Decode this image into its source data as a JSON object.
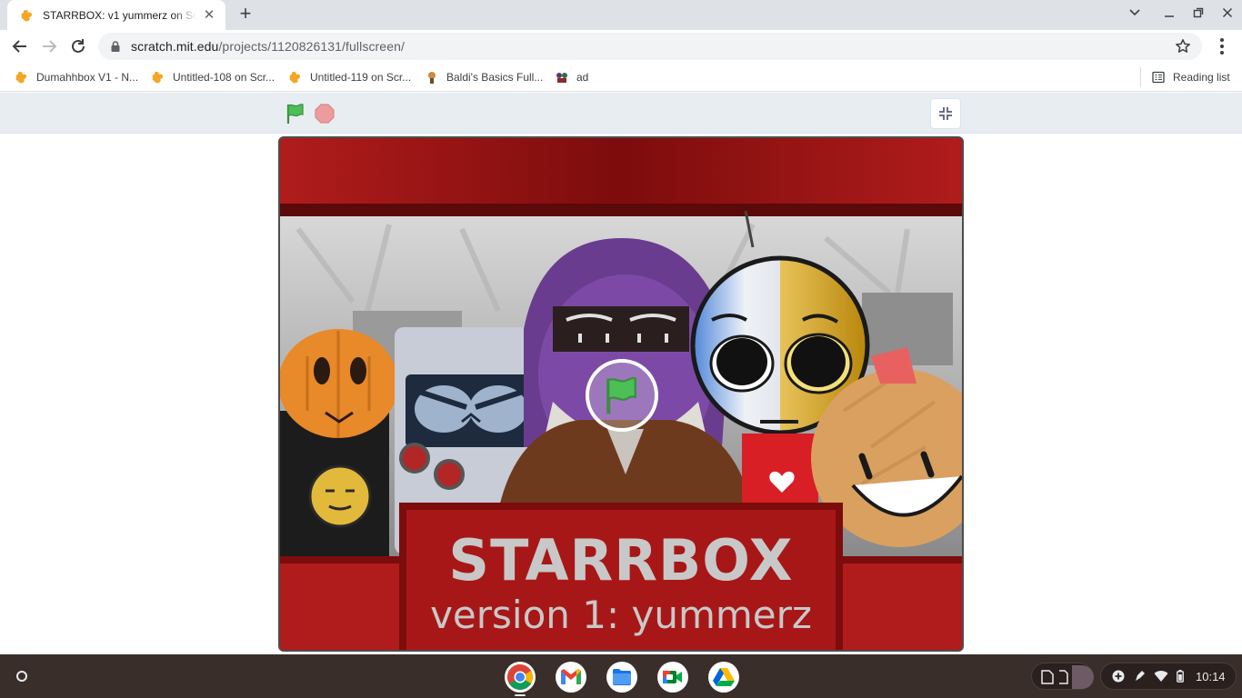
{
  "browser": {
    "tab": {
      "title": "STARRBOX: v1 yummerz on Scratch"
    },
    "url": {
      "host": "scratch.mit.edu",
      "path": "/projects/1120826131/fullscreen/"
    },
    "bookmarks": [
      {
        "label": "Dumahhbox V1 - N..."
      },
      {
        "label": "Untitled-108 on Scr..."
      },
      {
        "label": "Untitled-119 on Scr..."
      },
      {
        "label": "Baldi's Basics Full..."
      },
      {
        "label": "ad"
      }
    ],
    "reading_list": "Reading list"
  },
  "stage": {
    "title": "STARRBOX",
    "subtitle": "version 1: yummerz"
  },
  "colors": {
    "scratch_flag": "#4cbf56",
    "scratch_stop": "#ec9c9c",
    "stage_red": "#b01c1c",
    "scratch_orange": "#f5a623"
  },
  "shelf": {
    "apps": [
      "chrome-icon",
      "gmail-icon",
      "files-icon",
      "meet-icon",
      "drive-icon"
    ],
    "time": "10:14"
  }
}
